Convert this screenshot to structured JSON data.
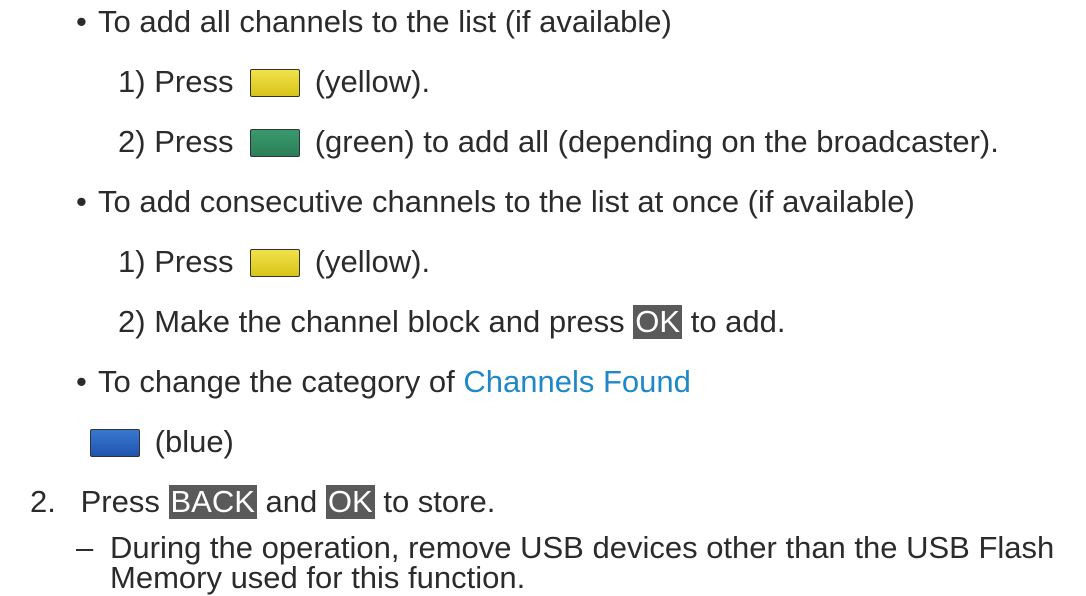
{
  "items": [
    {
      "type": "bullet",
      "text": "To add all channels to the list (if available)"
    },
    {
      "type": "step",
      "num": "1)",
      "pre": "Press",
      "key_color": "#e0cf2a",
      "post": "(yellow)."
    },
    {
      "type": "step",
      "num": "2)",
      "pre": "Press",
      "key_color": "#2f8c63",
      "post": "(green) to add all (depending on the broadcaster)."
    },
    {
      "type": "bullet",
      "text": "To add consecutive channels to the list at once (if available)"
    },
    {
      "type": "step",
      "num": "1)",
      "pre": "Press",
      "key_color": "#e0cf2a",
      "post": "(yellow)."
    },
    {
      "type": "step",
      "num": "2)",
      "pre": "Make the channel block and press",
      "button": "OK",
      "post": "to add."
    },
    {
      "type": "bullet",
      "pre": "To change the category of",
      "link": "Channels Found"
    },
    {
      "type": "key-only",
      "key_color": "#2a64c0",
      "post": "(blue)"
    }
  ],
  "main_step": {
    "num": "2.",
    "pre": "Press",
    "button1": "BACK",
    "mid": "and",
    "button2": "OK",
    "post": "to store."
  },
  "note": {
    "dash": "–",
    "line1": "During the operation, remove USB devices other than the USB Flash",
    "line2": "Memory used for this function."
  },
  "bullet_char": "•",
  "colors": {
    "text": "#2b2b2b",
    "link": "#1e88c8",
    "button_bg": "#5a5a5a",
    "yellow_key": "#e0cf2a",
    "green_key": "#2f8c63",
    "blue_key": "#2a64c0"
  }
}
